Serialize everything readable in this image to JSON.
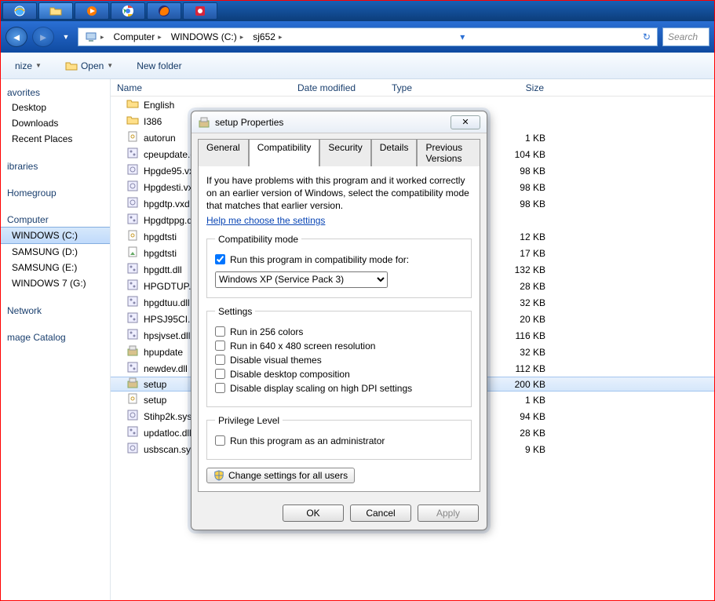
{
  "taskbar_icons": [
    "ie",
    "explorer",
    "wmp",
    "chrome",
    "firefox",
    "snagit"
  ],
  "breadcrumb": [
    "Computer",
    "WINDOWS (C:)",
    "sj652"
  ],
  "search_placeholder": "Search",
  "toolbar": {
    "organize": "nize",
    "open": "Open",
    "newfolder": "New folder"
  },
  "nav": {
    "favorites": {
      "header": "avorites",
      "items": [
        "Desktop",
        "Downloads",
        "Recent Places"
      ]
    },
    "libraries": {
      "header": "ibraries"
    },
    "homegroup": {
      "header": "Homegroup"
    },
    "computer": {
      "header": "Computer",
      "items": [
        "WINDOWS (C:)",
        "SAMSUNG (D:)",
        "SAMSUNG  (E:)",
        "WINDOWS 7 (G:)"
      ]
    },
    "network": {
      "header": "Network"
    },
    "catalog": {
      "header": "mage Catalog"
    }
  },
  "columns": {
    "name": "Name",
    "date": "Date modified",
    "type": "Type",
    "size": "Size"
  },
  "files": [
    {
      "name": "English",
      "size": "",
      "icon": "folder"
    },
    {
      "name": "I386",
      "size": "",
      "icon": "folder"
    },
    {
      "name": "autorun",
      "size": "1 KB",
      "icon": "inf"
    },
    {
      "name": "cpeupdate.dll",
      "size": "104 KB",
      "icon": "dll"
    },
    {
      "name": "Hpgde95.vxd",
      "size": "98 KB",
      "icon": "sys"
    },
    {
      "name": "Hpgdesti.vxd",
      "size": "98 KB",
      "icon": "sys"
    },
    {
      "name": "hpgdtp.vxd",
      "size": "98 KB",
      "icon": "sys"
    },
    {
      "name": "Hpgdtppg.dl",
      "size": "",
      "icon": "dll"
    },
    {
      "name": "hpgdtsti",
      "size": "12 KB",
      "icon": "inf"
    },
    {
      "name": "hpgdtsti",
      "size": "17 KB",
      "icon": "cat"
    },
    {
      "name": "hpgdtt.dll",
      "size": "132 KB",
      "icon": "dll"
    },
    {
      "name": "HPGDTUP.dll",
      "size": "28 KB",
      "icon": "dll"
    },
    {
      "name": "hpgdtuu.dll",
      "size": "32 KB",
      "icon": "dll"
    },
    {
      "name": "HPSJ95CI.DLL",
      "size": "20 KB",
      "icon": "dll"
    },
    {
      "name": "hpsjvset.dll",
      "size": "116 KB",
      "icon": "dll"
    },
    {
      "name": "hpupdate",
      "size": "32 KB",
      "icon": "exe"
    },
    {
      "name": "newdev.dll",
      "size": "112 KB",
      "icon": "dll"
    },
    {
      "name": "setup",
      "size": "200 KB",
      "icon": "exe",
      "selected": true
    },
    {
      "name": "setup",
      "size": "1 KB",
      "icon": "inf"
    },
    {
      "name": "Stihp2k.sys",
      "size": "94 KB",
      "icon": "sys"
    },
    {
      "name": "updatloc.dll",
      "size": "28 KB",
      "icon": "dll"
    },
    {
      "name": "usbscan.sys",
      "size": "9 KB",
      "icon": "sys"
    }
  ],
  "dialog": {
    "title": "setup Properties",
    "tabs": [
      "General",
      "Compatibility",
      "Security",
      "Details",
      "Previous Versions"
    ],
    "active_tab": "Compatibility",
    "intro": "If you have problems with this program and it worked correctly on an earlier version of Windows, select the compatibility mode that matches that earlier version.",
    "help_link": "Help me choose the settings",
    "group_compat": "Compatibility mode",
    "cb_run_mode": "Run this program in compatibility mode for:",
    "combo_value": "Windows XP (Service Pack 3)",
    "group_settings": "Settings",
    "cb_256": "Run in 256 colors",
    "cb_640": "Run in 640 x 480 screen resolution",
    "cb_vis": "Disable visual themes",
    "cb_comp": "Disable desktop composition",
    "cb_dpi": "Disable display scaling on high DPI settings",
    "group_priv": "Privilege Level",
    "cb_admin": "Run this program as an administrator",
    "btn_allusers": "Change settings for all users",
    "btn_ok": "OK",
    "btn_cancel": "Cancel",
    "btn_apply": "Apply"
  }
}
